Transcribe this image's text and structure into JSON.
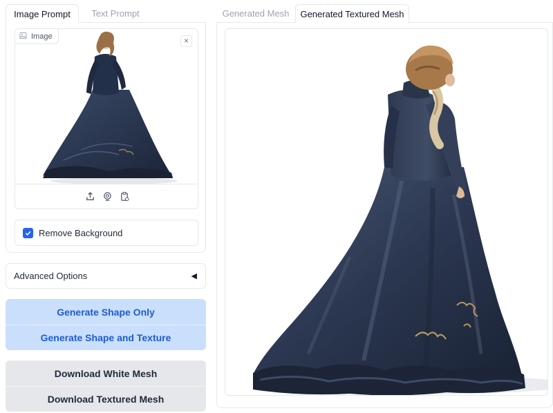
{
  "left_tabs": [
    {
      "label": "Image Prompt",
      "active": true
    },
    {
      "label": "Text Prompt",
      "active": false
    }
  ],
  "image_input": {
    "label": "Image",
    "label_icon": "image-icon",
    "toolbar_icons": [
      "upload-icon",
      "webcam-icon",
      "clipboard-icon"
    ]
  },
  "remove_background": {
    "label": "Remove Background",
    "checked": true
  },
  "advanced": {
    "label": "Advanced Options",
    "caret": "◀"
  },
  "generate_buttons": [
    "Generate Shape Only",
    "Generate Shape and Texture"
  ],
  "download_buttons": [
    "Download White Mesh",
    "Download Textured Mesh"
  ],
  "right_tabs": [
    {
      "label": "Generated Mesh",
      "active": false
    },
    {
      "label": "Generated Textured Mesh",
      "active": true
    }
  ],
  "colors": {
    "accent": "#2563eb",
    "button_blue_bg": "#c9dffc",
    "button_blue_text": "#1e5bd1",
    "button_gray_bg": "#e5e7eb",
    "dress": "#2b3a55",
    "hair": "#a7794a"
  }
}
